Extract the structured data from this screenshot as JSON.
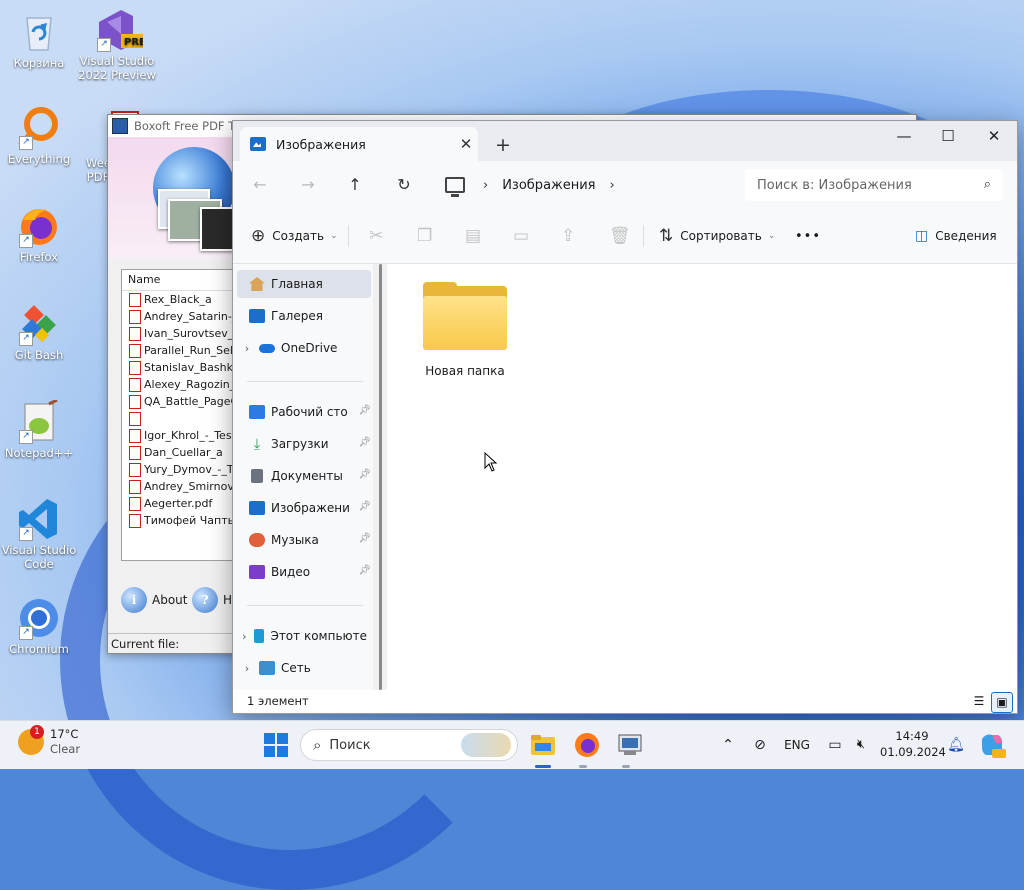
{
  "desktop": {
    "icons": [
      {
        "label": "Корзина",
        "icon": "recycle-bin-icon"
      },
      {
        "label": "Visual Studio 2022 Preview",
        "icon": "visual-studio-icon",
        "badge": "PRE"
      },
      {
        "label": "Everything",
        "icon": "everything-search-icon"
      },
      {
        "label": "Week PDF",
        "icon": "pdf-icon"
      },
      {
        "label": "Firefox",
        "icon": "firefox-icon"
      },
      {
        "label": "Git Bash",
        "icon": "git-icon"
      },
      {
        "label": "Notepad++",
        "icon": "notepadpp-icon"
      },
      {
        "label": "Visual Studio Code",
        "icon": "vscode-icon"
      },
      {
        "label": "Chromium",
        "icon": "chromium-icon"
      }
    ]
  },
  "boxoft": {
    "title": "Boxoft Free PDF To",
    "list_header": "Name",
    "files": [
      "Rex_Black_a",
      "Andrey_Satarin-_T",
      "Ivan_Surovtsev_-",
      "Parallel_Run_Seler",
      "Stanislav_Bashkyr",
      "Alexey_Ragozin_-",
      "QA_Battle_PageOI",
      "",
      "Igor_Khrol_-_Test",
      "Dan_Cuellar_a",
      "Yury_Dymov_-_Te",
      "Andrey_Smirnov.p",
      "Aegerter.pdf",
      "Тимофей Чаптыко"
    ],
    "about_label": "About",
    "help_label": "He",
    "status_label": "Current file:"
  },
  "explorer": {
    "tab_title": "Изображения",
    "new_tab": "+",
    "window_controls": {
      "minimize": "—",
      "maximize": "☐",
      "close": "✕"
    },
    "nav": {
      "back": "←",
      "forward": "→",
      "up": "↑",
      "refresh": "↻"
    },
    "address": {
      "location": "Изображения",
      "separator": "›"
    },
    "search_placeholder": "Поиск в: Изображения",
    "commands": {
      "create": "Создать",
      "sort": "Сортировать",
      "more": "•••",
      "details": "Сведения"
    },
    "navpane": {
      "home": "Главная",
      "gallery": "Галерея",
      "onedrive": "OneDrive",
      "pinned": [
        {
          "label": "Рабочий сто",
          "color": "#2c7be0"
        },
        {
          "label": "Загрузки",
          "color": "#2f9e58"
        },
        {
          "label": "Документы",
          "color": "#6b7280"
        },
        {
          "label": "Изображени",
          "color": "#1c6fc8"
        },
        {
          "label": "Музыка",
          "color": "#e0603a"
        },
        {
          "label": "Видео",
          "color": "#7a3ec9"
        }
      ],
      "this_pc": "Этот компьюте",
      "network": "Сеть"
    },
    "items": [
      {
        "name": "Новая папка",
        "type": "folder"
      }
    ],
    "status": "1 элемент"
  },
  "taskbar": {
    "weather": {
      "temp": "17°C",
      "condition": "Clear",
      "badge": "1"
    },
    "search_label": "Поиск",
    "language": "ENG",
    "time": "14:49",
    "date": "01.09.2024",
    "colors": {
      "accent": "#2b63c8"
    }
  }
}
